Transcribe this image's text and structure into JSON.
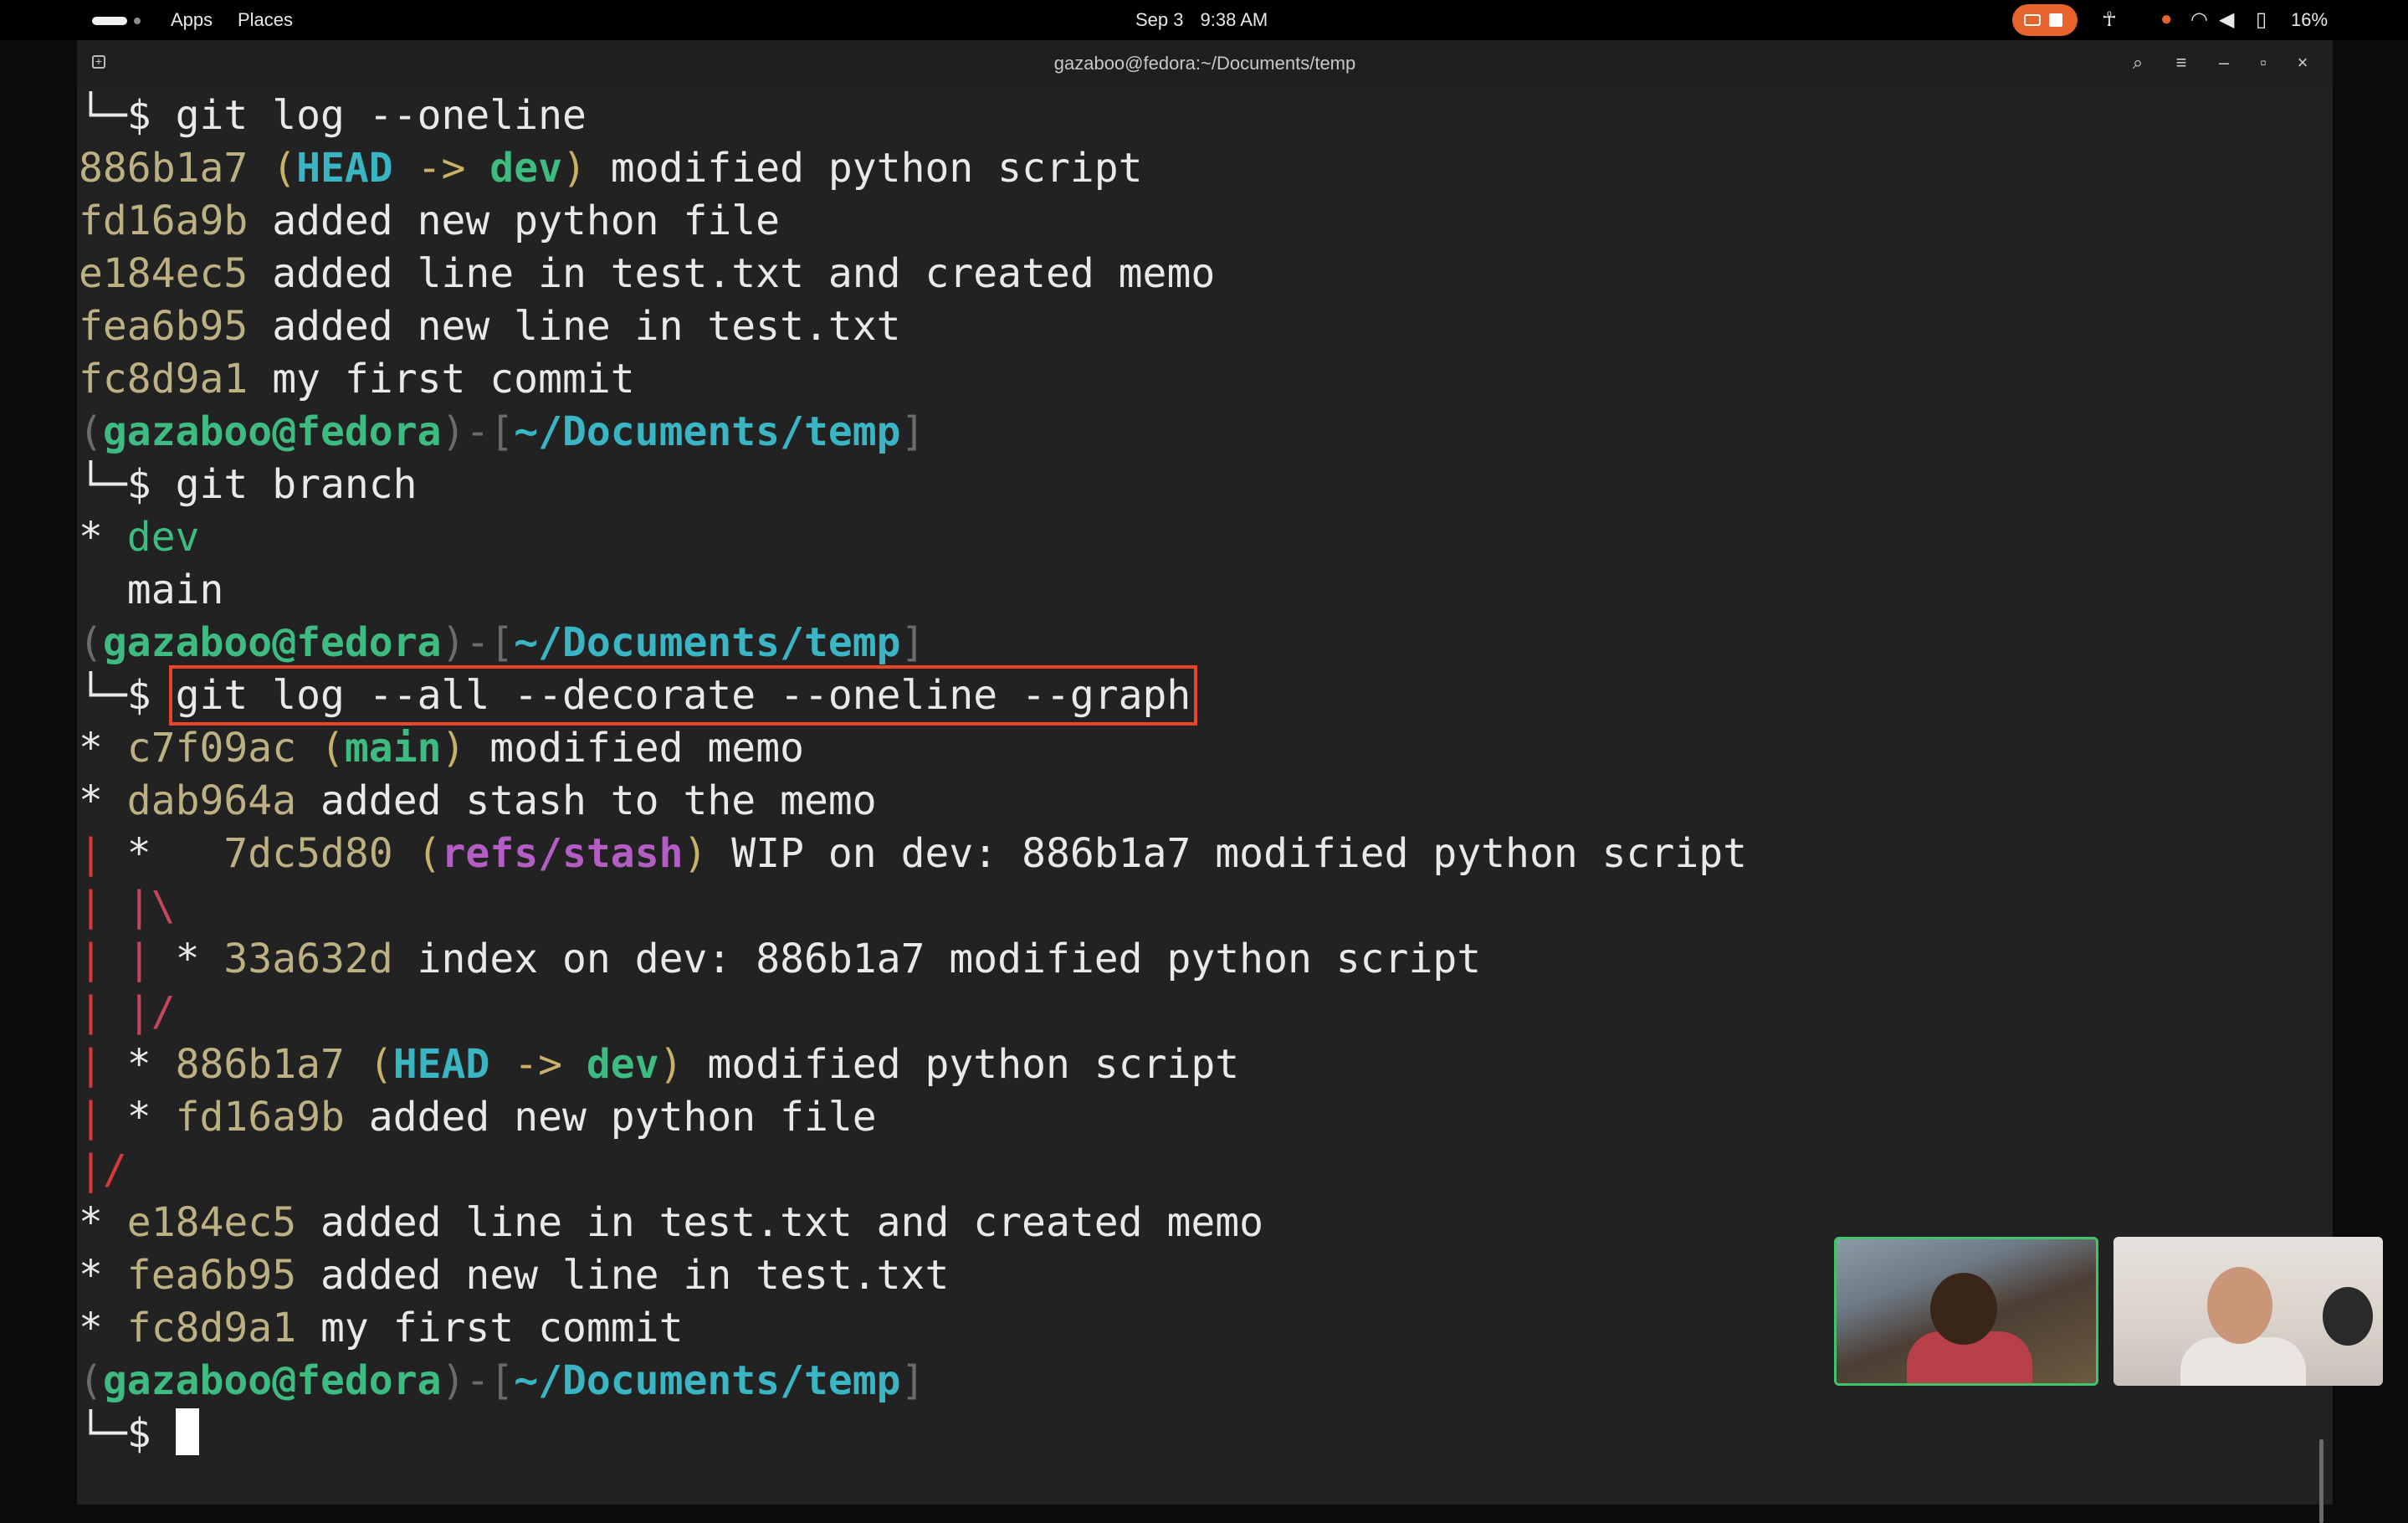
{
  "topbar": {
    "apps_label": "Apps",
    "places_label": "Places",
    "date": "Sep 3",
    "time": "9:38 AM",
    "battery_percent": "16%"
  },
  "window": {
    "title": "gazaboo@fedora:~/Documents/temp"
  },
  "prompt": {
    "user_host": "gazaboo@fedora",
    "path": "~/Documents/temp"
  },
  "terminal": {
    "cmd_log_oneline": "git log --oneline",
    "log1": [
      {
        "hash": "886b1a7",
        "msg": " modified python script",
        "head": "HEAD",
        "arrow": " -> ",
        "branch": "dev"
      },
      {
        "hash": "fd16a9b",
        "msg": " added new python file"
      },
      {
        "hash": "e184ec5",
        "msg": " added line in test.txt and created memo"
      },
      {
        "hash": "fea6b95",
        "msg": " added new line in test.txt"
      },
      {
        "hash": "fc8d9a1",
        "msg": " my first commit"
      }
    ],
    "cmd_branch": "git branch",
    "branches": {
      "current": "dev",
      "other": "main"
    },
    "cmd_graph": "git log --all --decorate --oneline --graph",
    "graph": {
      "c1": {
        "hash": "c7f09ac",
        "ref": "main",
        "msg": " modified memo"
      },
      "c2": {
        "hash": "dab964a",
        "msg": " added stash to the memo"
      },
      "c3": {
        "hash": "7dc5d80",
        "ref": "refs/stash",
        "msg": " WIP on dev: 886b1a7 modified python script"
      },
      "c4": {
        "hash": "33a632d",
        "msg": " index on dev: 886b1a7 modified python script"
      },
      "c5": {
        "hash": "886b1a7",
        "head": "HEAD",
        "arrow": " -> ",
        "branch": "dev",
        "msg": " modified python script"
      },
      "c6": {
        "hash": "fd16a9b",
        "msg": " added new python file"
      },
      "c7": {
        "hash": "e184ec5",
        "msg": " added line in test.txt and created memo"
      },
      "c8": {
        "hash": "fea6b95",
        "msg": " added new line in test.txt"
      },
      "c9": {
        "hash": "fc8d9a1",
        "msg": " my first commit"
      }
    }
  },
  "colors": {
    "accent_highlight": "#e8452a",
    "branch_green": "#3dbb80",
    "head_cyan": "#3ab5c4",
    "stash_purple": "#b45ec5",
    "hash_tan": "#bdb083",
    "graph_red": "#d7393a"
  },
  "icons": [
    "new-tab-icon",
    "search-icon",
    "menu-icon",
    "minimize-icon",
    "maximize-icon",
    "close-icon",
    "screen-record-icon",
    "accessibility-icon",
    "microphone-icon",
    "wifi-icon",
    "volume-icon",
    "battery-icon"
  ]
}
